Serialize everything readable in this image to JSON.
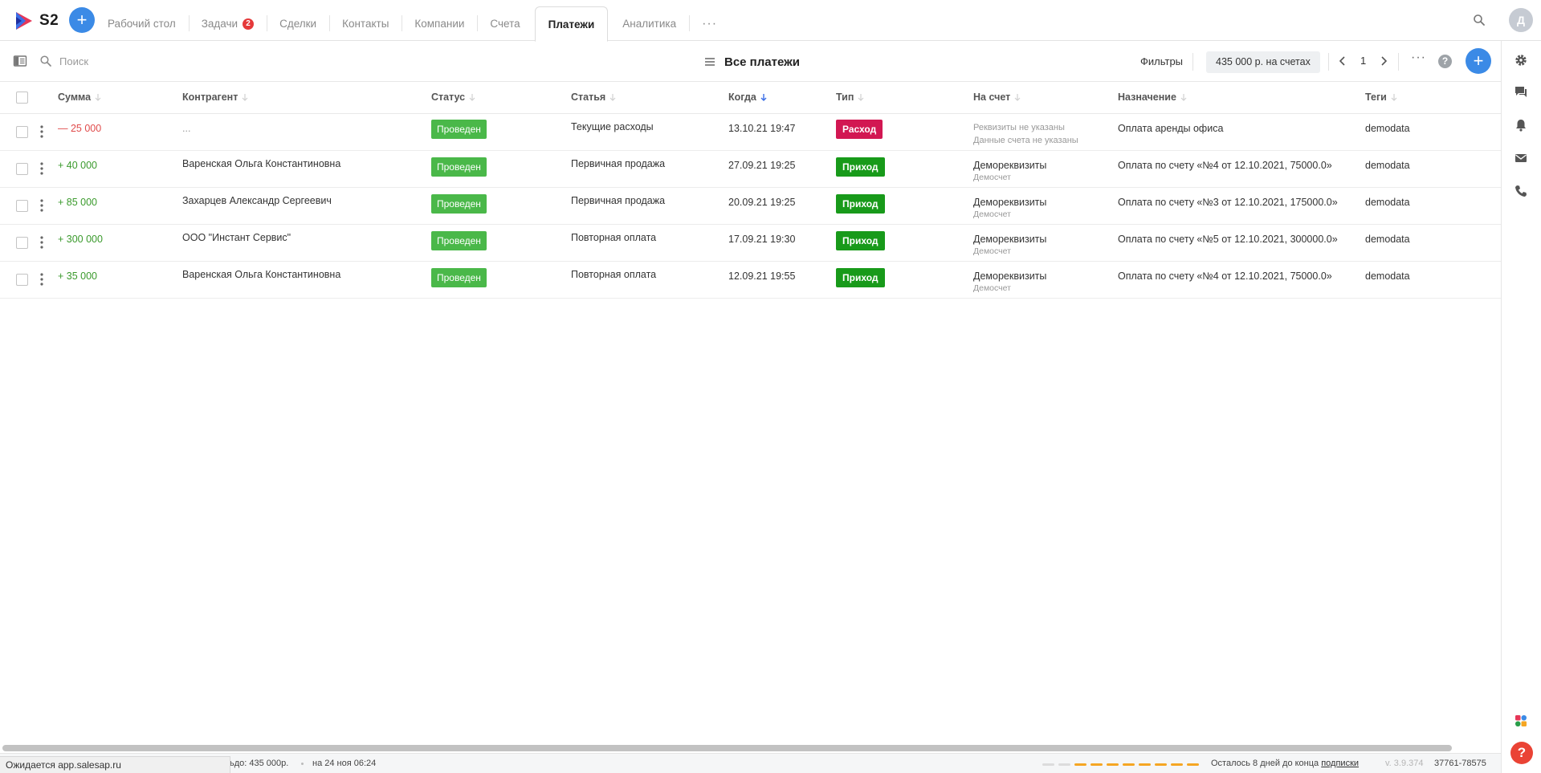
{
  "app": {
    "logo_text": "S2",
    "user_initial": "Д"
  },
  "nav": {
    "tabs": [
      {
        "label": "Рабочий стол",
        "active": false
      },
      {
        "label": "Задачи",
        "active": false,
        "badge": "2"
      },
      {
        "label": "Сделки",
        "active": false
      },
      {
        "label": "Контакты",
        "active": false
      },
      {
        "label": "Компании",
        "active": false
      },
      {
        "label": "Счета",
        "active": false
      },
      {
        "label": "Платежи",
        "active": true
      },
      {
        "label": "Аналитика",
        "active": false
      }
    ],
    "more_label": "···"
  },
  "toolbar": {
    "search_placeholder": "Поиск",
    "view_title": "Все платежи",
    "filters_label": "Фильтры",
    "balance_label": "435 000 р. на счетах",
    "page_number": "1",
    "more_label": "···",
    "help_label": "?"
  },
  "table": {
    "columns": [
      "Сумма",
      "Контрагент",
      "Статус",
      "Статья",
      "Когда",
      "Тип",
      "На счет",
      "Назначение",
      "Теги"
    ],
    "rows": [
      {
        "amount": "— 25 000",
        "sign": "neg",
        "counterparty": "...",
        "status": "Проведен",
        "article": "Текущие расходы",
        "when": "13.10.21 19:47",
        "type": "Расход",
        "type_kind": "out",
        "account_main": "Реквизиты не указаны",
        "account_sub": "Данные счета не указаны",
        "purpose": "Оплата аренды офиса",
        "tags": "demodata"
      },
      {
        "amount": "+ 40 000",
        "sign": "pos",
        "counterparty": "Варенская Ольга Константиновна",
        "status": "Проведен",
        "article": "Первичная продажа",
        "when": "27.09.21 19:25",
        "type": "Приход",
        "type_kind": "in",
        "account_main": "Демореквизиты",
        "account_sub": "Демосчет",
        "purpose": "Оплата по счету «№4 от 12.10.2021, 75000.0»",
        "tags": "demodata"
      },
      {
        "amount": "+ 85 000",
        "sign": "pos",
        "counterparty": "Захарцев Александр Сергеевич",
        "status": "Проведен",
        "article": "Первичная продажа",
        "when": "20.09.21 19:25",
        "type": "Приход",
        "type_kind": "in",
        "account_main": "Демореквизиты",
        "account_sub": "Демосчет",
        "purpose": "Оплата по счету «№3 от 12.10.2021, 175000.0»",
        "tags": "demodata"
      },
      {
        "amount": "+ 300 000",
        "sign": "pos",
        "counterparty": "ООО \"Инстант Сервис\"",
        "status": "Проведен",
        "article": "Повторная оплата",
        "when": "17.09.21 19:30",
        "type": "Приход",
        "type_kind": "in",
        "account_main": "Демореквизиты",
        "account_sub": "Демосчет",
        "purpose": "Оплата по счету «№5 от 12.10.2021, 300000.0»",
        "tags": "demodata"
      },
      {
        "amount": "+ 35 000",
        "sign": "pos",
        "counterparty": "Варенская Ольга Константиновна",
        "status": "Проведен",
        "article": "Повторная оплата",
        "when": "12.09.21 19:55",
        "type": "Приход",
        "type_kind": "in",
        "account_main": "Демореквизиты",
        "account_sub": "Демосчет",
        "purpose": "Оплата по счету «№4 от 12.10.2021, 75000.0»",
        "tags": "demodata"
      }
    ]
  },
  "statusbar": {
    "loading_text": "Ожидается app.salesap.ru",
    "balance_text": "ьдо: 435 000р.",
    "date_text": "на 24 ноя 06:24",
    "subscription_text": "Осталось 8 дней до конца ",
    "subscription_link": "подписки",
    "version": "v. 3.9.374",
    "build": "37761-78575"
  },
  "colors": {
    "accent": "#3b8ae6",
    "status_ok": "#4ab849",
    "type_in": "#189a1a",
    "type_out": "#d21752",
    "amount_neg": "#e04b4b",
    "amount_pos": "#3a9a2c",
    "progress": "#f5a623"
  },
  "icons": {
    "top": [
      "logo-icon",
      "plus-icon",
      "search-icon",
      "avatar"
    ],
    "rail": [
      "gear-icon",
      "chat-icon",
      "bell-icon",
      "mail-icon",
      "phone-icon",
      "apps-icon",
      "help-icon"
    ],
    "toolbar": [
      "sidebar-toggle-icon",
      "search-icon",
      "hamburger-icon",
      "chevron-left-icon",
      "chevron-right-icon",
      "more-icon",
      "help-icon",
      "plus-icon"
    ]
  }
}
